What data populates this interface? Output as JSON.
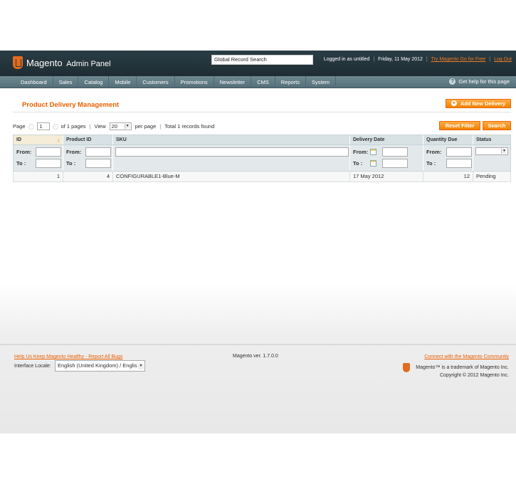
{
  "header": {
    "logo_text": "Magento",
    "logo_sub": "Admin Panel",
    "global_search": "Global Record Search",
    "logged_in": "Logged in as untitled",
    "date": "Friday, 11 May 2012",
    "try_link": "Try Magento Go for Free",
    "logout": "Log Out",
    "sep": "|"
  },
  "nav": {
    "items": [
      "Dashboard",
      "Sales",
      "Catalog",
      "Mobile",
      "Customers",
      "Promotions",
      "Newsletter",
      "CMS",
      "Reports",
      "System"
    ],
    "help": "Get help for this page"
  },
  "page": {
    "title": "Product Delivery Management",
    "add_button": "Add New Delivery",
    "reset_button": "Reset Filter",
    "search_button": "Search"
  },
  "pager": {
    "page_label": "Page",
    "page_value": "1",
    "of_pages": "of 1 pages",
    "view_label": "View",
    "per_page_value": "20",
    "per_page_label": "per page",
    "total": "Total 1 records found",
    "sep": "|"
  },
  "grid": {
    "columns": [
      "ID",
      "Product ID",
      "SKU",
      "Delivery Date",
      "Quantity Due",
      "Status"
    ],
    "filter_from": "From:",
    "filter_to": "To :",
    "rows": [
      {
        "id": "1",
        "product_id": "4",
        "sku": "CONFIGURABLE1-Blue-M",
        "delivery_date": "17 May 2012",
        "quantity_due": "12",
        "status": "Pending"
      }
    ]
  },
  "footer": {
    "bugs_link": "Help Us Keep Magento Healthy - Report All Bugs",
    "version": "Magento ver. 1.7.0.0",
    "community_link": "Connect with the Magento Community",
    "locale_label": "Interface Locale:",
    "locale_value": "English (United Kingdom) / Englis",
    "trademark": "Magento™ is a trademark of Magento Inc.",
    "copyright": "Copyright © 2012 Magento Inc."
  },
  "colors": {
    "accent": "#eb5e00",
    "header": "#2a3d45",
    "nav": "#6f8992"
  }
}
